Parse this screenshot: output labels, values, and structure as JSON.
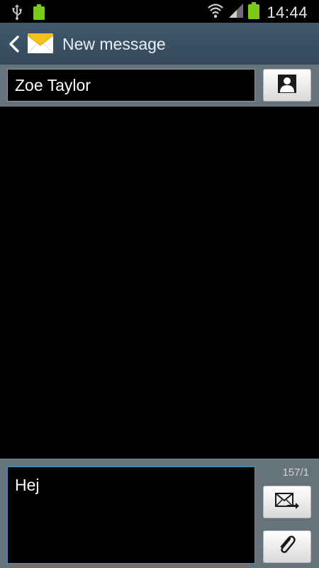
{
  "status_bar": {
    "time": "14:44",
    "battery_small_label": "100%",
    "icons": [
      "usb-icon",
      "battery-full-icon",
      "wifi-icon",
      "signal-icon",
      "battery-icon"
    ]
  },
  "action_bar": {
    "title": "New message",
    "icons": [
      "back-chevron-icon",
      "envelope-app-icon"
    ]
  },
  "recipient": {
    "value": "Zoe Taylor",
    "contact_icon": "contact-person-icon"
  },
  "composer": {
    "message_value": "Hej",
    "char_counter": "157/1",
    "send_icon": "send-message-icon",
    "attach_icon": "paperclip-icon"
  },
  "colors": {
    "action_bar": "#3f596c",
    "panel": "#66737a",
    "focus_border": "#2f9bd8",
    "battery_green": "#7ccb1a"
  }
}
